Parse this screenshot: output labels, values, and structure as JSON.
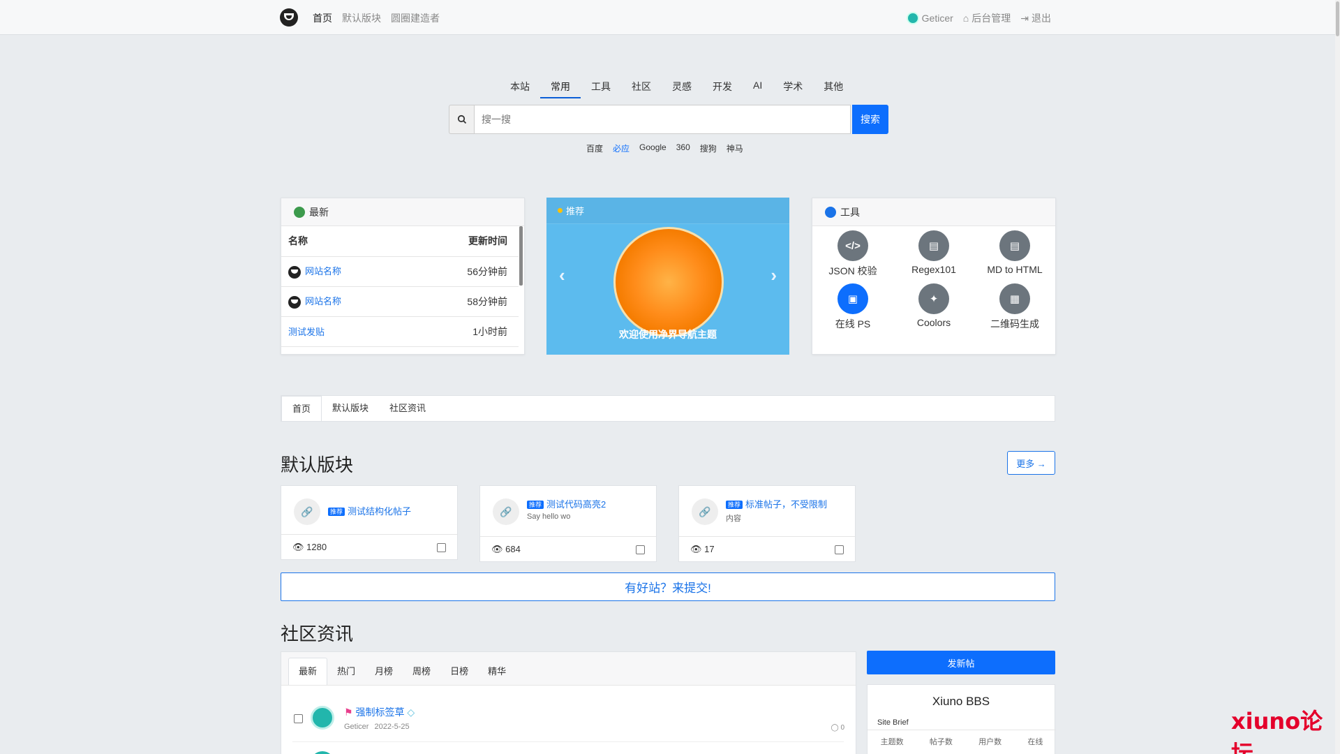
{
  "nav": {
    "items": [
      "首页",
      "默认版块",
      "圆圈建造者"
    ],
    "user": "Geticer",
    "admin": "后台管理",
    "logout": "退出"
  },
  "search": {
    "tabs": [
      "本站",
      "常用",
      "工具",
      "社区",
      "灵感",
      "开发",
      "AI",
      "学术",
      "其他"
    ],
    "placeholder": "搜一搜",
    "button": "搜索",
    "engines": [
      "百度",
      "必应",
      "Google",
      "360",
      "搜狗",
      "神马"
    ]
  },
  "latest": {
    "title": "最新",
    "col_name": "名称",
    "col_time": "更新时间",
    "rows": [
      {
        "name": "网站名称",
        "time": "56分钟前"
      },
      {
        "name": "网站名称",
        "time": "58分钟前"
      },
      {
        "name": "测试发贴",
        "time": "1小时前"
      }
    ]
  },
  "recommend": {
    "title": "推荐",
    "caption": "欢迎使用净界导航主题"
  },
  "tools": {
    "title": "工具",
    "items": [
      {
        "label": "JSON 校验",
        "glyph": "</>"
      },
      {
        "label": "Regex101",
        "glyph": "▤"
      },
      {
        "label": "MD to HTML",
        "glyph": "▤"
      },
      {
        "label": "在线 PS",
        "glyph": "▣"
      },
      {
        "label": "Coolors",
        "glyph": "✦"
      },
      {
        "label": "二维码生成",
        "glyph": "▦"
      }
    ]
  },
  "tabbar": [
    "首页",
    "默认版块",
    "社区资讯"
  ],
  "section1": {
    "title": "默认版块",
    "more": "更多 →"
  },
  "posts": [
    {
      "badge": "推荐",
      "title": "测试结构化帖子",
      "sub": "",
      "views": "1280"
    },
    {
      "badge": "推荐",
      "title": "测试代码高亮2",
      "sub": "Say hello wo",
      "views": "684"
    },
    {
      "badge": "推荐",
      "title": "标准帖子，不受限制",
      "sub": "内容",
      "views": "17"
    }
  ],
  "submit_bar": "有好站？来提交!",
  "section2": {
    "title": "社区资讯"
  },
  "community": {
    "tabs": [
      "最新",
      "热门",
      "月榜",
      "周榜",
      "日榜",
      "精华"
    ],
    "thread": {
      "title": "强制标签草",
      "author": "Geticer",
      "date": "2022-5-25",
      "replies": "0"
    }
  },
  "sidebar": {
    "new_post": "发新帖",
    "bbs_name": "Xiuno BBS",
    "brief": "Site Brief",
    "stats": [
      "主题数",
      "帖子数",
      "用户数",
      "在线"
    ]
  },
  "watermark": "xiuno论坛",
  "colors": {
    "primary": "#0d6efd",
    "link": "#1a73e8",
    "recommend_bg": "#5cbbee"
  }
}
